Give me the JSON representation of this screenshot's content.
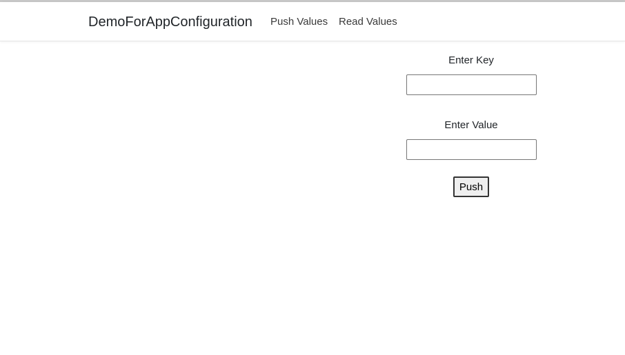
{
  "navbar": {
    "brand": "DemoForAppConfiguration",
    "links": [
      {
        "label": "Push Values"
      },
      {
        "label": "Read Values"
      }
    ]
  },
  "form": {
    "key_label": "Enter Key",
    "key_value": "",
    "value_label": "Enter Value",
    "value_value": "",
    "push_label": "Push"
  },
  "colors": {
    "text": "#212529",
    "nav_link": "#393939",
    "button_bg": "#efefef",
    "input_border": "#767676"
  }
}
